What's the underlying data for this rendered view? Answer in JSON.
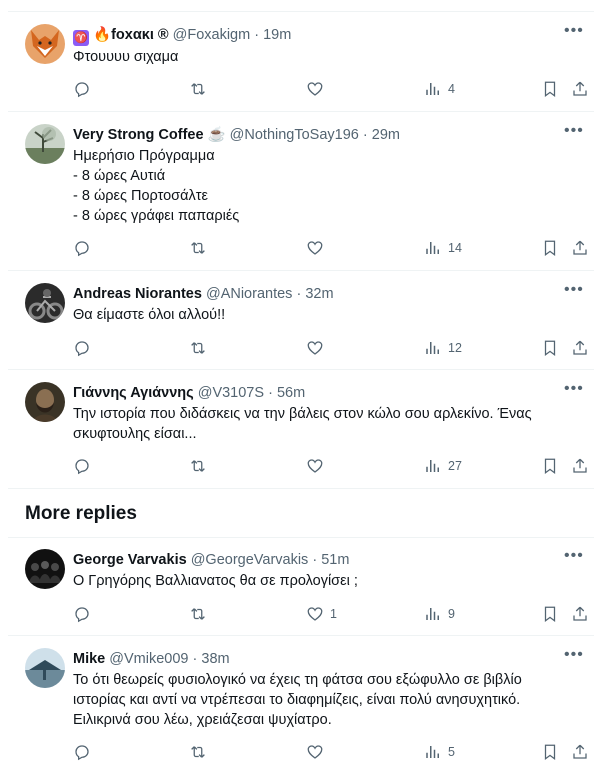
{
  "tweets": [
    {
      "name": "foxακι",
      "name_prefix_icons": [
        "aries-icon",
        "fire-icon"
      ],
      "name_suffix": "®",
      "handle": "@Foxakigm",
      "time": "19m",
      "text": "Φτουυυυ σιχαμα",
      "replies": "",
      "retweets": "",
      "likes": "",
      "views": "4"
    },
    {
      "name": "Very Strong Coffee",
      "name_suffix_icon": "coffee-icon",
      "handle": "@NothingToSay196",
      "time": "29m",
      "text": "Ημερήσιο Πρόγραμμα\n- 8 ώρες Αυτιά\n- 8 ώρες Πορτοσάλτε\n- 8 ώρες γράφει παπαριές",
      "replies": "",
      "retweets": "",
      "likes": "",
      "views": "14"
    },
    {
      "name": "Andreas Niorantes",
      "handle": "@ANiorantes",
      "time": "32m",
      "text": "Θα είμαστε όλοι αλλού!!",
      "replies": "",
      "retweets": "",
      "likes": "",
      "views": "12"
    },
    {
      "name": "Γιάννης Αγιάννης",
      "handle": "@V3107S",
      "time": "56m",
      "text": "Την ιστορία που διδάσκεις να την βάλεις στον κώλο σου αρλεκίνο. Ένας\nσκυφτουλης είσαι...",
      "replies": "",
      "retweets": "",
      "likes": "",
      "views": "27"
    },
    {
      "name": "George Varvakis",
      "handle": "@GeorgeVarvakis",
      "time": "51m",
      "text": "Ο Γρηγόρης Βαλλιανατος θα σε προλογίσει ;",
      "replies": "",
      "retweets": "",
      "likes": "1",
      "views": "9"
    },
    {
      "name": "Mike",
      "handle": "@Vmike009",
      "time": "38m",
      "text": "Το ότι θεωρείς φυσιολογικό να έχεις τη φάτσα σου εξώφυλλο σε βιβλίο\nιστορίας και αντί να ντρέπεσαι το διαφημίζεις, είναι πολύ ανησυχητικό.\nΕιλικρινά σου λέω, χρειάζεσαι ψυχίατρο.",
      "replies": "",
      "retweets": "",
      "likes": "",
      "views": "5"
    }
  ],
  "sections": {
    "more_replies": "More replies"
  },
  "separator_dot": "·",
  "more_glyph": "•••",
  "colors": {
    "text": "#0f1419",
    "secondary": "#536471",
    "divider": "#eff3f4"
  }
}
